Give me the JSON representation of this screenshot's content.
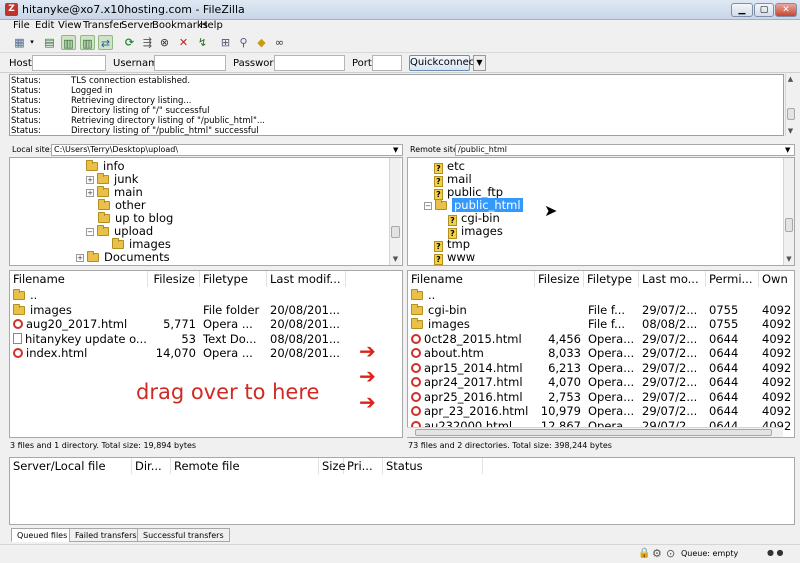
{
  "window": {
    "title": "hitanyke@xo7.x10hosting.com - FileZilla"
  },
  "menu": [
    "File",
    "Edit",
    "View",
    "Transfer",
    "Server",
    "Bookmarks",
    "Help"
  ],
  "quickconnect": {
    "host_label": "Host:",
    "host_value": "",
    "username_label": "Username:",
    "username_value": "",
    "password_label": "Password:",
    "password_value": "",
    "port_label": "Port:",
    "port_value": "",
    "button_label": "Quickconnect"
  },
  "log": [
    {
      "label": "Status:",
      "text": "TLS connection established."
    },
    {
      "label": "Status:",
      "text": "Logged in"
    },
    {
      "label": "Status:",
      "text": "Retrieving directory listing..."
    },
    {
      "label": "Status:",
      "text": "Directory listing of \"/\" successful"
    },
    {
      "label": "Status:",
      "text": "Retrieving directory listing of \"/public_html\"..."
    },
    {
      "label": "Status:",
      "text": "Directory listing of \"/public_html\" successful"
    }
  ],
  "local": {
    "site_label": "Local site:",
    "path": "C:\\Users\\Terry\\Desktop\\upload\\",
    "tree": [
      {
        "name": "info",
        "depth": 0,
        "expander": ""
      },
      {
        "name": "junk",
        "depth": 0,
        "expander": "+"
      },
      {
        "name": "main",
        "depth": 0,
        "expander": "+"
      },
      {
        "name": "other",
        "depth": 0,
        "expander": ""
      },
      {
        "name": "up to blog",
        "depth": 0,
        "expander": ""
      },
      {
        "name": "upload",
        "depth": 0,
        "expander": "-"
      },
      {
        "name": "images",
        "depth": 1,
        "expander": ""
      },
      {
        "name": "Documents",
        "depth": -1,
        "expander": "+"
      }
    ],
    "headers": [
      "Filename",
      "Filesize",
      "Filetype",
      "Last modif..."
    ],
    "files": [
      {
        "icon": "folder",
        "name": "..",
        "size": "",
        "type": "",
        "modified": ""
      },
      {
        "icon": "folder",
        "name": "images",
        "size": "",
        "type": "File folder",
        "modified": "20/08/201..."
      },
      {
        "icon": "opera",
        "name": "aug20_2017.html",
        "size": "5,771",
        "type": "Opera ...",
        "modified": "20/08/201..."
      },
      {
        "icon": "text",
        "name": "hitanykey update o...",
        "size": "53",
        "type": "Text Do...",
        "modified": "08/08/201..."
      },
      {
        "icon": "opera",
        "name": "index.html",
        "size": "14,070",
        "type": "Opera ...",
        "modified": "20/08/201..."
      }
    ],
    "status": "3 files and 1 directory. Total size: 19,894 bytes"
  },
  "remote": {
    "site_label": "Remote site:",
    "path": "/public_html",
    "tree": [
      {
        "name": "etc",
        "depth": 0,
        "icon": "q",
        "selected": false
      },
      {
        "name": "mail",
        "depth": 0,
        "icon": "q",
        "selected": false
      },
      {
        "name": "public_ftp",
        "depth": 0,
        "icon": "q",
        "selected": false
      },
      {
        "name": "public_html",
        "depth": 0,
        "icon": "folder",
        "selected": true
      },
      {
        "name": "cgi-bin",
        "depth": 1,
        "icon": "q",
        "selected": false
      },
      {
        "name": "images",
        "depth": 1,
        "icon": "q",
        "selected": false
      },
      {
        "name": "tmp",
        "depth": 0,
        "icon": "q",
        "selected": false
      },
      {
        "name": "www",
        "depth": 0,
        "icon": "q",
        "selected": false
      }
    ],
    "headers": [
      "Filename",
      "Filesize",
      "Filetype",
      "Last mo...",
      "Permi...",
      "Own"
    ],
    "files": [
      {
        "icon": "folder",
        "name": "..",
        "size": "",
        "type": "",
        "modified": "",
        "perm": "",
        "owner": ""
      },
      {
        "icon": "folder",
        "name": "cgi-bin",
        "size": "",
        "type": "File f...",
        "modified": "29/07/2...",
        "perm": "0755",
        "owner": "4092"
      },
      {
        "icon": "folder",
        "name": "images",
        "size": "",
        "type": "File f...",
        "modified": "08/08/2...",
        "perm": "0755",
        "owner": "4092"
      },
      {
        "icon": "opera",
        "name": "0ct28_2015.html",
        "size": "4,456",
        "type": "Opera...",
        "modified": "29/07/2...",
        "perm": "0644",
        "owner": "4092"
      },
      {
        "icon": "opera",
        "name": "about.htm",
        "size": "8,033",
        "type": "Opera...",
        "modified": "29/07/2...",
        "perm": "0644",
        "owner": "4092"
      },
      {
        "icon": "opera",
        "name": "apr15_2014.html",
        "size": "6,213",
        "type": "Opera...",
        "modified": "29/07/2...",
        "perm": "0644",
        "owner": "4092"
      },
      {
        "icon": "opera",
        "name": "apr24_2017.html",
        "size": "4,070",
        "type": "Opera...",
        "modified": "29/07/2...",
        "perm": "0644",
        "owner": "4092"
      },
      {
        "icon": "opera",
        "name": "apr25_2016.html",
        "size": "2,753",
        "type": "Opera...",
        "modified": "29/07/2...",
        "perm": "0644",
        "owner": "4092"
      },
      {
        "icon": "opera",
        "name": "apr_23_2016.html",
        "size": "10,979",
        "type": "Opera...",
        "modified": "29/07/2...",
        "perm": "0644",
        "owner": "4092"
      },
      {
        "icon": "opera",
        "name": "au232000.html",
        "size": "12,867",
        "type": "Opera...",
        "modified": "29/07/2...",
        "perm": "0644",
        "owner": "4092"
      }
    ],
    "status": "73 files and 2 directories. Total size: 398,244 bytes"
  },
  "annotation": {
    "text": "drag over to here",
    "color": "#d12a22"
  },
  "queue": {
    "headers": [
      "Server/Local file",
      "Dir...",
      "Remote file",
      "Size",
      "Pri...",
      "Status"
    ],
    "tabs": [
      "Queued files",
      "Failed transfers",
      "Successful transfers"
    ]
  },
  "statusbar": {
    "queue": "Queue: empty"
  }
}
